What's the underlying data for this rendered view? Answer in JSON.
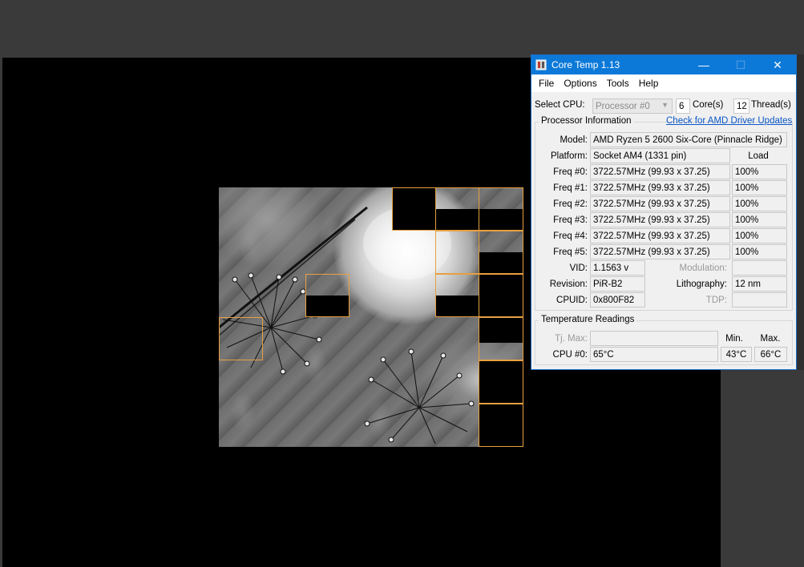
{
  "window": {
    "title": "Core Temp 1.13",
    "minimize": "—",
    "maximize": "☐",
    "close": "✕"
  },
  "menu": [
    "File",
    "Options",
    "Tools",
    "Help"
  ],
  "select_cpu": {
    "label": "Select CPU:",
    "value": "Processor #0",
    "cores_value": "6",
    "cores_label": "Core(s)",
    "threads_value": "12",
    "threads_label": "Thread(s)"
  },
  "processor_info": {
    "title": "Processor Information",
    "link": "Check for AMD Driver Updates",
    "model_label": "Model:",
    "model": "AMD Ryzen 5 2600 Six-Core (Pinnacle Ridge)",
    "platform_label": "Platform:",
    "platform": "Socket AM4 (1331 pin)",
    "load_header": "Load",
    "freqs": [
      {
        "label": "Freq #0:",
        "value": "3722.57MHz (99.93 x 37.25)",
        "load": "100%"
      },
      {
        "label": "Freq #1:",
        "value": "3722.57MHz (99.93 x 37.25)",
        "load": "100%"
      },
      {
        "label": "Freq #2:",
        "value": "3722.57MHz (99.93 x 37.25)",
        "load": "100%"
      },
      {
        "label": "Freq #3:",
        "value": "3722.57MHz (99.93 x 37.25)",
        "load": "100%"
      },
      {
        "label": "Freq #4:",
        "value": "3722.57MHz (99.93 x 37.25)",
        "load": "100%"
      },
      {
        "label": "Freq #5:",
        "value": "3722.57MHz (99.93 x 37.25)",
        "load": "100%"
      }
    ],
    "vid_label": "VID:",
    "vid": "1.1563 v",
    "modulation_label": "Modulation:",
    "modulation": "",
    "revision_label": "Revision:",
    "revision": "PiR-B2",
    "lithography_label": "Lithography:",
    "lithography": "12 nm",
    "cpuid_label": "CPUID:",
    "cpuid": "0x800F82",
    "tdp_label": "TDP:",
    "tdp": ""
  },
  "temps": {
    "title": "Temperature Readings",
    "tjmax_label": "Tj. Max:",
    "tjmax": "",
    "min_header": "Min.",
    "max_header": "Max.",
    "cpu_label": "CPU #0:",
    "cpu_value": "65°C",
    "cpu_min": "43°C",
    "cpu_max": "66°C"
  },
  "colors": {
    "titlebar": "#0c79d8",
    "tile_border": "#e8a040",
    "link": "#0b57c9"
  }
}
